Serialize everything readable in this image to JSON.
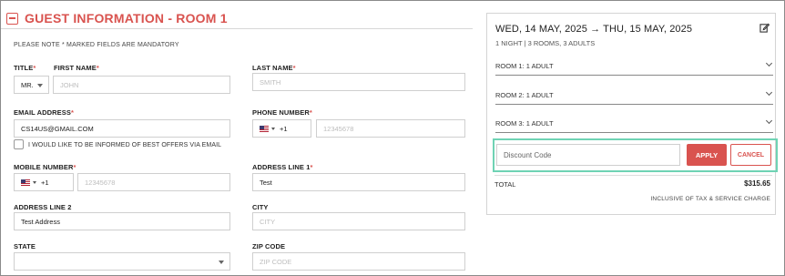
{
  "header": {
    "title": "GUEST INFORMATION - ROOM  1"
  },
  "note": "PLEASE NOTE * MARKED FIELDS ARE MANDATORY",
  "form": {
    "title": {
      "label": "TITLE",
      "value": "MR."
    },
    "first_name": {
      "label": "FIRST NAME",
      "placeholder": "JOHN"
    },
    "last_name": {
      "label": "LAST NAME",
      "placeholder": "SMITH"
    },
    "email": {
      "label": "EMAIL ADDRESS",
      "value": "CS14US@GMAIL.COM"
    },
    "phone": {
      "label": "PHONE NUMBER",
      "code": "+1",
      "placeholder": "12345678"
    },
    "offers_checkbox": {
      "label": "I WOULD LIKE TO BE INFORMED OF BEST OFFERS VIA EMAIL"
    },
    "mobile": {
      "label": "MOBILE NUMBER",
      "code": "+1",
      "placeholder": "12345678"
    },
    "address1": {
      "label": "ADDRESS LINE 1",
      "value": "Test"
    },
    "address2": {
      "label": "ADDRESS LINE 2",
      "value": "Test Address"
    },
    "city": {
      "label": "CITY",
      "placeholder": "CITY"
    },
    "state": {
      "label": "STATE",
      "value": ""
    },
    "zip": {
      "label": "ZIP CODE",
      "placeholder": "ZIP CODE"
    },
    "required_mark": "*"
  },
  "booking": {
    "dates": "WED, 14 MAY, 2025 → THU, 15 MAY, 2025",
    "summary": "1 NIGHT | 3 ROOMS, 3 ADULTS",
    "rooms": [
      {
        "label": "ROOM 1: 1 ADULT"
      },
      {
        "label": "ROOM 2: 1 ADULT"
      },
      {
        "label": "ROOM 3: 1 ADULT"
      }
    ],
    "discount": {
      "placeholder": "Discount Code",
      "apply": "APPLY",
      "cancel": "CANCEL"
    },
    "total_label": "TOTAL",
    "total_value": "$315.65",
    "tax_note": "INCLUSIVE OF TAX & SERVICE CHARGE"
  },
  "colors": {
    "accent": "#d9534f",
    "highlight": "#6fd3b4"
  }
}
